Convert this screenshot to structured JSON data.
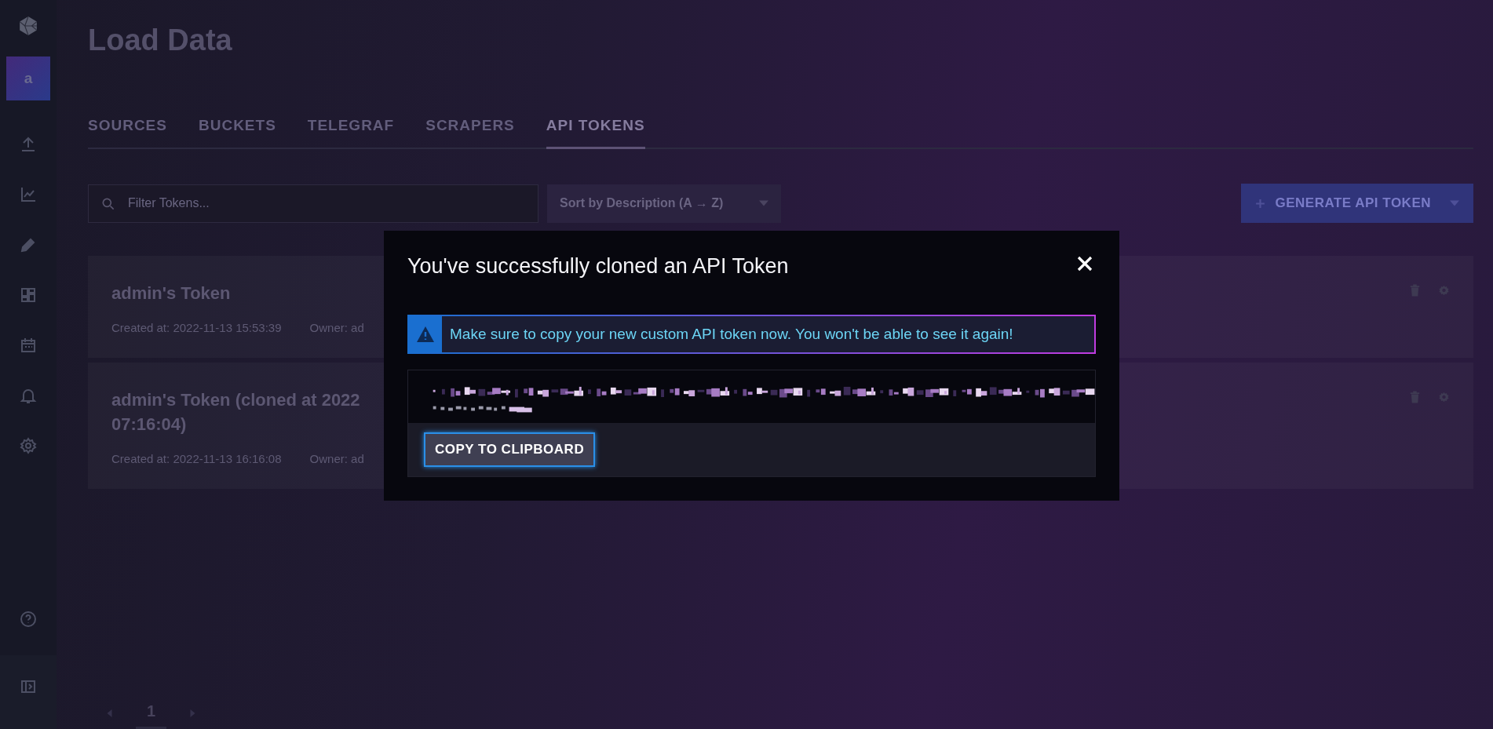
{
  "sidebar": {
    "avatar": "a"
  },
  "page": {
    "title": "Load Data"
  },
  "tabs": [
    {
      "label": "SOURCES",
      "selected": false
    },
    {
      "label": "BUCKETS",
      "selected": false
    },
    {
      "label": "TELEGRAF",
      "selected": false
    },
    {
      "label": "SCRAPERS",
      "selected": false
    },
    {
      "label": "API TOKENS",
      "selected": true
    }
  ],
  "filter": {
    "placeholder": "Filter Tokens..."
  },
  "sort": {
    "label": "Sort by Description (A → Z)"
  },
  "generate_button": {
    "label": "GENERATE API TOKEN"
  },
  "tokens": [
    {
      "title_lines": [
        "admin's Token"
      ],
      "created": "Created at: 2022-11-13 15:53:39",
      "owner": "Owner: ad"
    },
    {
      "title_lines": [
        "admin's Token (cloned at 2022",
        "07:16:04)"
      ],
      "created": "Created at: 2022-11-13 16:16:08",
      "owner": "Owner: ad"
    }
  ],
  "pagination": {
    "pages": [
      {
        "label": "1",
        "selected": true
      }
    ]
  },
  "dialog": {
    "title": "You've successfully cloned an API Token",
    "alert": "Make sure to copy your new custom API token now. You won't be able to see it again!",
    "button": "COPY TO CLIPBOARD"
  }
}
